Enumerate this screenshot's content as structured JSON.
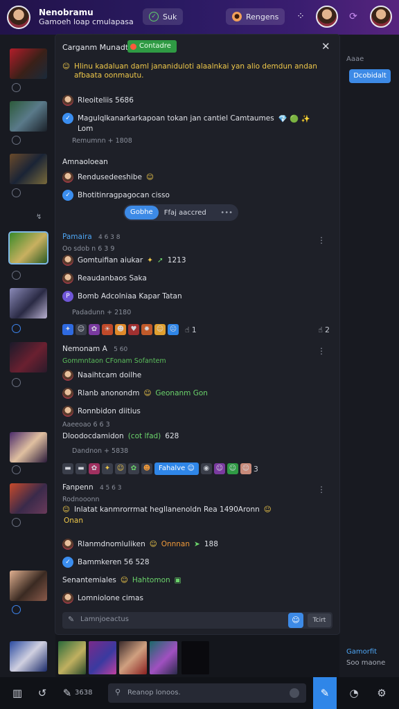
{
  "header": {
    "title_line1": "Nenobramu",
    "title_line2": "Gamoeh loap cmulapasa",
    "status_pill": "Suk",
    "group_pill": "Rengens"
  },
  "right_column": {
    "label": "Aaae",
    "button": "Dcobidalt",
    "footer_link": "Gamorfit",
    "footer_meta": "Soo maone"
  },
  "chat": {
    "title": "Carganm Munadt",
    "status_badge": "Contadre",
    "post1": {
      "text": "Hlinu kadaluan daml jananiduloti alaalnkai yan alio demdun andan afbaata oonmautu.",
      "reply_author": "Rleoiteliis 5686",
      "reply_text": "Magulqlkanarkarkapoan tokan jan cantiel Camtaumes",
      "reply_icons": "💎 🟢 ✨",
      "reply_tail": "Lom",
      "meta": "Remumnn + 1808"
    },
    "section1": {
      "label": "Amnaoloean",
      "item1": "Rendusedeeshibe",
      "item2": "Bhotitinragpagocan cisso",
      "reply_button": "Gobhe",
      "reply_label": "Ffaj aaccred"
    },
    "post2": {
      "name": "Pamaira",
      "name_meta": "4 6 3 8",
      "sub": "Oo sdob n 6 3 9",
      "line1": "Gomtuifian aiukar",
      "line1_meta": "1213",
      "line2": "Reaudanbaos Saka",
      "line3": "Bomb Adcolniaa Kapar Tatan",
      "meta": "Padadunn + 2180",
      "emoji_count1": "1",
      "emoji_count2": "2"
    },
    "post3": {
      "name": "Nemonam A",
      "name_meta": "5 60",
      "sub": "Gommntaon CFonam Sofantem",
      "line1": "Naaihtcam doilhe",
      "line2": "Rlanb anonondm",
      "line2_accent": "Geonanm Gon",
      "line3": "Ronnbidon diitius",
      "meta_a": "Aaeeoao 6 6 3",
      "line4": "Dloodocdamidon",
      "line4_accent": "(cot lfad)",
      "line4_meta": "628",
      "meta_b": "Dandnon + 5838",
      "emoji_button": "Fahalve",
      "emoji_count": "3"
    },
    "post4": {
      "name": "Fanpenn",
      "name_meta": "4 5 6 3",
      "sub": "Rodnooonn",
      "line1": "Inlatat kanmrorrmat hegllanenoldn Rea 1490Aronn",
      "line1_tail": "Onan",
      "line2": "Rlanmdnomluliken",
      "line2_accent": "Onnnan",
      "line2_meta": "188",
      "line3": "Bammkeren 56 528",
      "line4": "Senantemiales",
      "line4_accent": "Hahtomon",
      "line5": "Lomniolone cimas"
    },
    "input_placeholder": "Lamnjoeactus",
    "input_alt": "Tcirt"
  },
  "bottom_bar": {
    "count": "3638",
    "search_placeholder": "Reanop lonoos."
  },
  "colors": {
    "accent": "#2f86e8",
    "status_green": "#2f9a44",
    "panel": "#1e2028",
    "header_gradient_start": "#22134a",
    "header_gradient_end": "#57247e"
  }
}
